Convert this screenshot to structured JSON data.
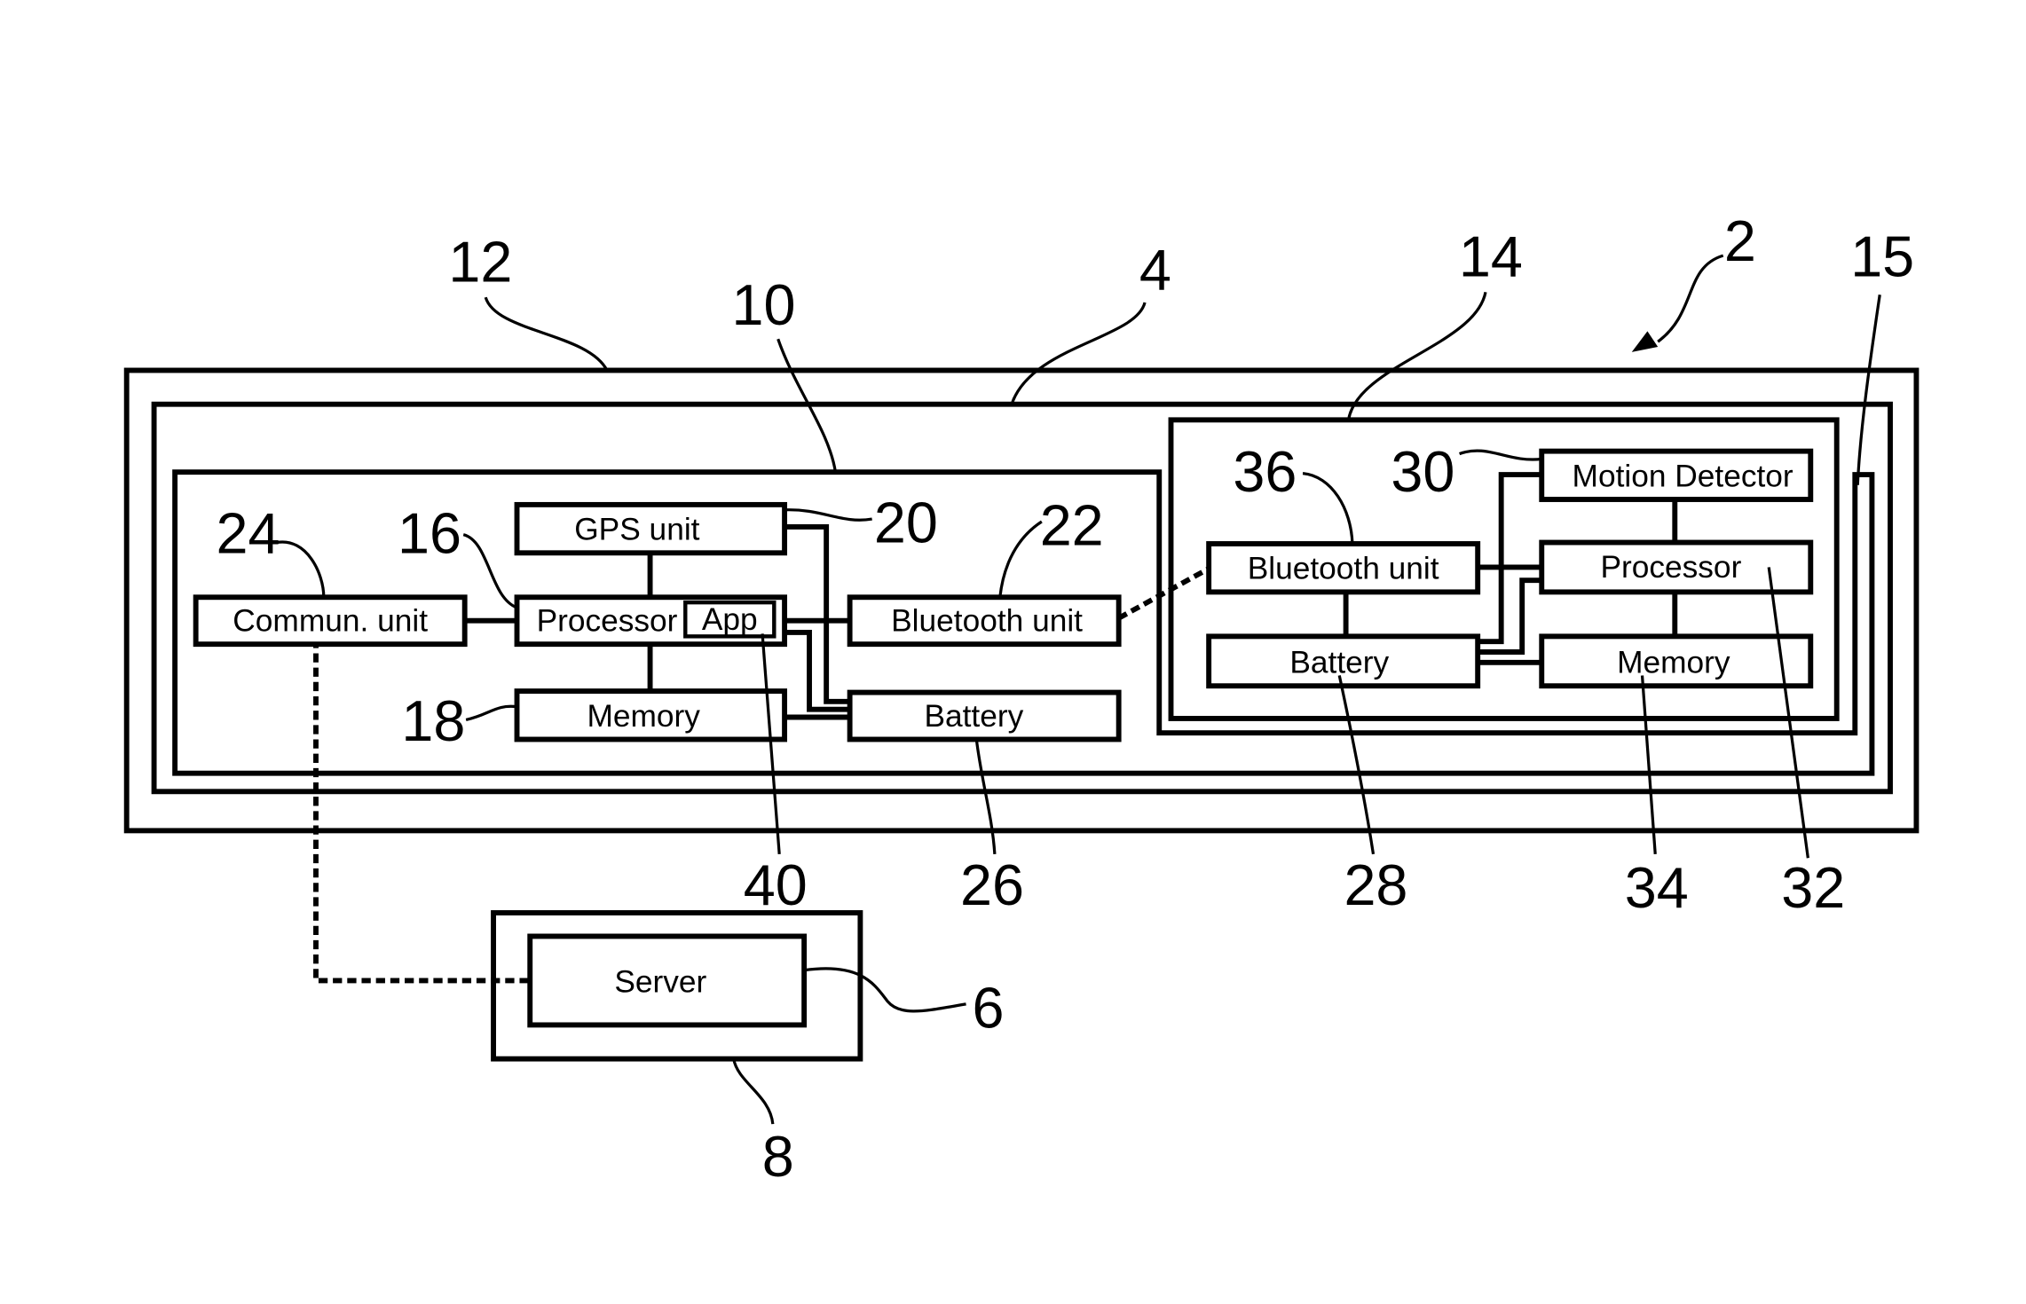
{
  "figure": {
    "type": "block-diagram",
    "reference_numerals": {
      "system": "2",
      "vehicle_frame": "4",
      "server": "6",
      "server_housing": "8",
      "mobile_device": "10",
      "outer_enclosure": "12",
      "sensor_module": "14",
      "module_housing": "15",
      "processor": "16",
      "memory": "18",
      "gps_unit": "20",
      "bluetooth_unit": "22",
      "communication_unit": "24",
      "battery": "26",
      "module_battery": "28",
      "motion_detector": "30",
      "module_processor": "32",
      "module_memory": "34",
      "module_bluetooth": "36",
      "app": "40"
    },
    "mobile_device": {
      "commun_unit": "Commun. unit",
      "processor": "Processor",
      "app": "App",
      "gps_unit": "GPS unit",
      "memory": "Memory",
      "bluetooth_unit": "Bluetooth unit",
      "battery": "Battery"
    },
    "sensor_module": {
      "motion_detector": "Motion Detector",
      "bluetooth_unit": "Bluetooth unit",
      "processor": "Processor",
      "battery": "Battery",
      "memory": "Memory"
    },
    "server": {
      "label": "Server"
    }
  }
}
